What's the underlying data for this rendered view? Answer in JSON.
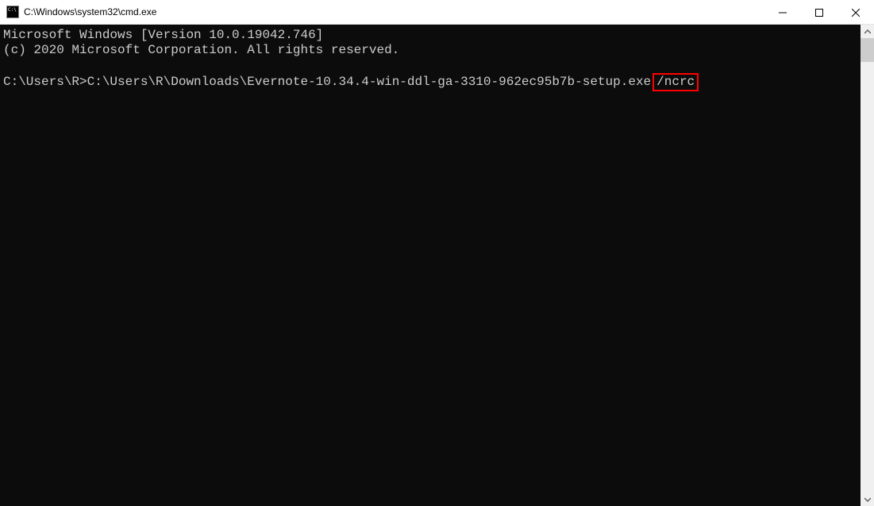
{
  "titlebar": {
    "title": "C:\\Windows\\system32\\cmd.exe"
  },
  "terminal": {
    "line1": "Microsoft Windows [Version 10.0.19042.746]",
    "line2": "(c) 2020 Microsoft Corporation. All rights reserved.",
    "prompt": "C:\\Users\\R>",
    "command": "C:\\Users\\R\\Downloads\\Evernote-10.34.4-win-ddl-ga-3310-962ec95b7b-setup.exe",
    "highlighted_arg": "/ncrc"
  }
}
